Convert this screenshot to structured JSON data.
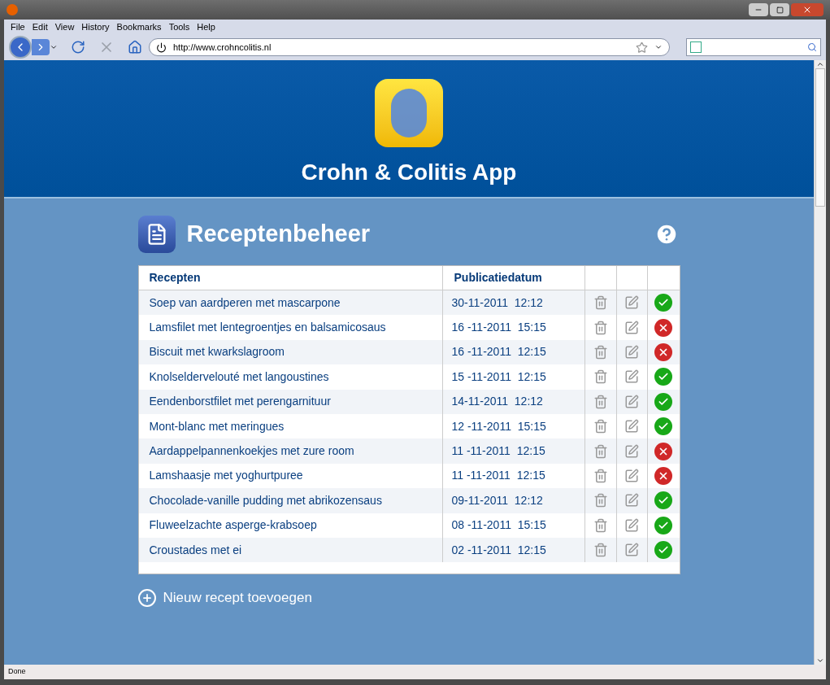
{
  "menu": [
    "File",
    "Edit",
    "View",
    "History",
    "Bookmarks",
    "Tools",
    "Help"
  ],
  "address": {
    "value": "http://www.crohncolitis.nl"
  },
  "app_title": "Crohn & Colitis App",
  "page_title": "Receptenbeheer",
  "table": {
    "columns": [
      "Recepten",
      "Publicatiedatum"
    ],
    "rows": [
      {
        "name": "Soep van aardperen met mascarpone",
        "date": "30-11-2011  12:12",
        "published": true
      },
      {
        "name": "Lamsfilet met lentegroentjes en balsamicosaus",
        "date": "16 -11-2011  15:15",
        "published": false
      },
      {
        "name": "Biscuit met kwarkslagroom",
        "date": "16 -11-2011  12:15",
        "published": false
      },
      {
        "name": "Knolseldervelouté met langoustines",
        "date": "15 -11-2011  12:15",
        "published": true
      },
      {
        "name": "Eendenborstfilet met perengarnituur",
        "date": "14-11-2011  12:12",
        "published": true
      },
      {
        "name": "Mont-blanc met meringues",
        "date": "12 -11-2011  15:15",
        "published": true
      },
      {
        "name": "Aardappelpannenkoekjes met zure room",
        "date": "11 -11-2011  12:15",
        "published": false
      },
      {
        "name": "Lamshaasje met yoghurtpuree",
        "date": "11 -11-2011  12:15",
        "published": false
      },
      {
        "name": "Chocolade-vanille pudding met abrikozensaus",
        "date": "09-11-2011  12:12",
        "published": true
      },
      {
        "name": "Fluweelzachte asperge-krabsoep",
        "date": "08 -11-2011  15:15",
        "published": true
      },
      {
        "name": "Croustades met ei",
        "date": "02 -11-2011  12:15",
        "published": true
      }
    ]
  },
  "add_link": "Nieuw recept toevoegen",
  "status_bar": "Done"
}
